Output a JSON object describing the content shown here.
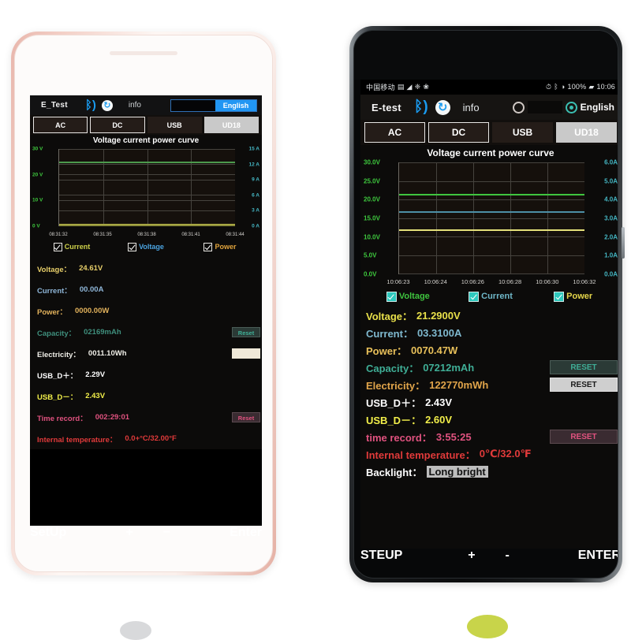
{
  "left_phone": {
    "header": {
      "title": "E_Test",
      "bluetooth_icon": "bluetooth-icon",
      "refresh_icon": "refresh-icon",
      "info_label": "info",
      "lang_off_label": "",
      "lang_on_label": "English"
    },
    "tabs": [
      {
        "label": "AC",
        "style": "outlined"
      },
      {
        "label": "DC",
        "style": "outlined"
      },
      {
        "label": "USB",
        "style": "plain"
      },
      {
        "label": "UD18",
        "style": "active"
      }
    ],
    "chart_title": "Voltage current power curve",
    "checkboxes": [
      {
        "label": "Current",
        "color": "#cfd24a",
        "checked": true
      },
      {
        "label": "Voltage",
        "color": "#4aa3e0",
        "checked": true
      },
      {
        "label": "Power",
        "color": "#e0a33c",
        "checked": true
      }
    ],
    "readout": [
      {
        "label": "Voltage：",
        "value": "24.61V",
        "color": "#e8cf6a",
        "reset": null
      },
      {
        "label": "Current：",
        "value": "00.00A",
        "color": "#8fb6d8",
        "reset": null
      },
      {
        "label": "Power：",
        "value": "0000.00W",
        "color": "#e2b25c",
        "reset": null
      },
      {
        "label": "Capacity：",
        "value": "02169mAh",
        "color": "#3f8f7d",
        "reset": "Reset",
        "reset_style": "teal"
      },
      {
        "label": "Electricity：",
        "value": "0011.10Wh",
        "color": "#f0efe8",
        "reset": "",
        "reset_style": "cream"
      },
      {
        "label": "USB_D＋：",
        "value": "2.29V",
        "color": "#ffffff",
        "reset": null
      },
      {
        "label": "USB_D－：",
        "value": "2.43V",
        "color": "#f2ef4a",
        "reset": null
      },
      {
        "label": "Time record：",
        "value": "002:29:01",
        "color": "#e0527f",
        "reset": "Reset",
        "reset_style": "pink"
      },
      {
        "label": "Internal temperature：",
        "value": "0.0+°C/32.00°F",
        "color": "#e03a3a",
        "reset": null
      }
    ],
    "controls": {
      "setup": "SetUp",
      "minus": "−",
      "plus": "+",
      "enter": "Enter"
    }
  },
  "right_phone": {
    "statusbar": {
      "carrier": "中国移动",
      "left_icons": [
        "sim-icon",
        "signal-icon",
        "wifi-icon",
        "sync-icon"
      ],
      "right_icons": [
        "alarm-icon",
        "bluetooth-icon",
        "vibrate-icon",
        "battery-icon"
      ],
      "battery_percent": "100%",
      "time": "10:06"
    },
    "header": {
      "title": "E-test",
      "bluetooth_icon": "bluetooth-icon",
      "refresh_icon": "refresh-icon",
      "info_label": "info",
      "lang_on_label": "English"
    },
    "tabs": [
      {
        "label": "AC",
        "style": "outlined"
      },
      {
        "label": "DC",
        "style": "outlined"
      },
      {
        "label": "USB",
        "style": "plain"
      },
      {
        "label": "UD18",
        "style": "active"
      }
    ],
    "chart_title": "Voltage current power curve",
    "checkboxes": [
      {
        "label": "Voltage",
        "color": "#3fc43f",
        "checked": true
      },
      {
        "label": "Current",
        "color": "#6fb7c8",
        "checked": true
      },
      {
        "label": "Power",
        "color": "#e4d54a",
        "checked": true
      }
    ],
    "readout": [
      {
        "label": "Voltage：",
        "value": "21.2900V",
        "color": "#e8e04a",
        "reset": null
      },
      {
        "label": "Current：",
        "value": "03.3100A",
        "color": "#7fb9cf",
        "reset": null
      },
      {
        "label": "Power：",
        "value": "0070.47W",
        "color": "#e8c05a",
        "reset": null
      },
      {
        "label": "Capacity：",
        "value": "07212mAh",
        "color": "#3fae96",
        "reset": "RESET",
        "reset_style": "teal"
      },
      {
        "label": "Electricity：",
        "value": "122770mWh",
        "color": "#e0a44a",
        "reset": "RESET",
        "reset_style": "light"
      },
      {
        "label": "USB_D＋：",
        "value": "2.43V",
        "color": "#ffffff",
        "reset": null
      },
      {
        "label": "USB_D－：",
        "value": "2.60V",
        "color": "#f2ef4a",
        "reset": null
      },
      {
        "label": "time record：",
        "value": "3:55:25",
        "color": "#e0527f",
        "reset": "RESET",
        "reset_style": "pink"
      },
      {
        "label": "Internal temperature：",
        "value": "0℃/32.0℉",
        "color": "#e03a3a",
        "reset": null
      },
      {
        "label": "Backlight：",
        "value": "Long bright",
        "color": "#ffffff",
        "reset": null,
        "value_highlight": true
      }
    ],
    "controls": {
      "setup": "STEUP",
      "minus": "-",
      "plus": "+",
      "enter": "ENTER"
    }
  },
  "chart_data": [
    {
      "id": "left",
      "type": "line",
      "title": "Voltage current power curve",
      "xlabel": "",
      "ylabel": "V",
      "y2label": "A",
      "ylim": [
        0,
        30
      ],
      "y2lim": [
        0,
        15
      ],
      "grid": true,
      "yticks": [
        "0 V",
        "10 V",
        "20 V",
        "30 V"
      ],
      "ytick_values": [
        0,
        10,
        20,
        30
      ],
      "y2ticks": [
        "0 A",
        "3 A",
        "6 A",
        "9 A",
        "12 A",
        "15 A"
      ],
      "y2tick_values": [
        0,
        3,
        6,
        9,
        12,
        15
      ],
      "x": [
        "08:31:32",
        "08:31:35",
        "08:31:38",
        "08:31:41",
        "08:31:44"
      ],
      "series": [
        {
          "name": "Voltage",
          "color": "#4d9a4d",
          "axis": "left",
          "constant": 24.61
        },
        {
          "name": "Current",
          "color": "#b8b84a",
          "axis": "left",
          "constant": 0.2
        },
        {
          "name": "Power",
          "color": "#8f8f3a",
          "axis": "left",
          "constant": 0.0
        }
      ],
      "legend": [
        "Current",
        "Voltage",
        "Power"
      ],
      "legend_position": "below"
    },
    {
      "id": "right",
      "type": "line",
      "title": "Voltage current power curve",
      "xlabel": "",
      "ylabel": "V",
      "y2label": "A",
      "ylim": [
        0,
        30
      ],
      "y2lim": [
        0,
        6
      ],
      "grid": true,
      "yticks": [
        "0.0V",
        "5.0V",
        "10.0V",
        "15.0V",
        "20.0V",
        "25.0V",
        "30.0V"
      ],
      "ytick_values": [
        0,
        5,
        10,
        15,
        20,
        25,
        30
      ],
      "y2ticks": [
        "0.0A",
        "1.0A",
        "2.0A",
        "3.0A",
        "4.0A",
        "5.0A",
        "6.0A"
      ],
      "y2tick_values": [
        0,
        1,
        2,
        3,
        4,
        5,
        6
      ],
      "x": [
        "10:06:23",
        "10:06:24",
        "10:06:26",
        "10:06:28",
        "10:06:30",
        "10:06:32"
      ],
      "series": [
        {
          "name": "Voltage",
          "color": "#3fc43f",
          "axis": "left",
          "constant": 21.29
        },
        {
          "name": "Current",
          "color": "#4d8fa6",
          "axis": "left",
          "constant": 16.5
        },
        {
          "name": "Power",
          "color": "#e4e07a",
          "axis": "left",
          "constant": 11.7
        }
      ],
      "legend": [
        "Voltage",
        "Current",
        "Power"
      ],
      "legend_position": "below"
    }
  ]
}
